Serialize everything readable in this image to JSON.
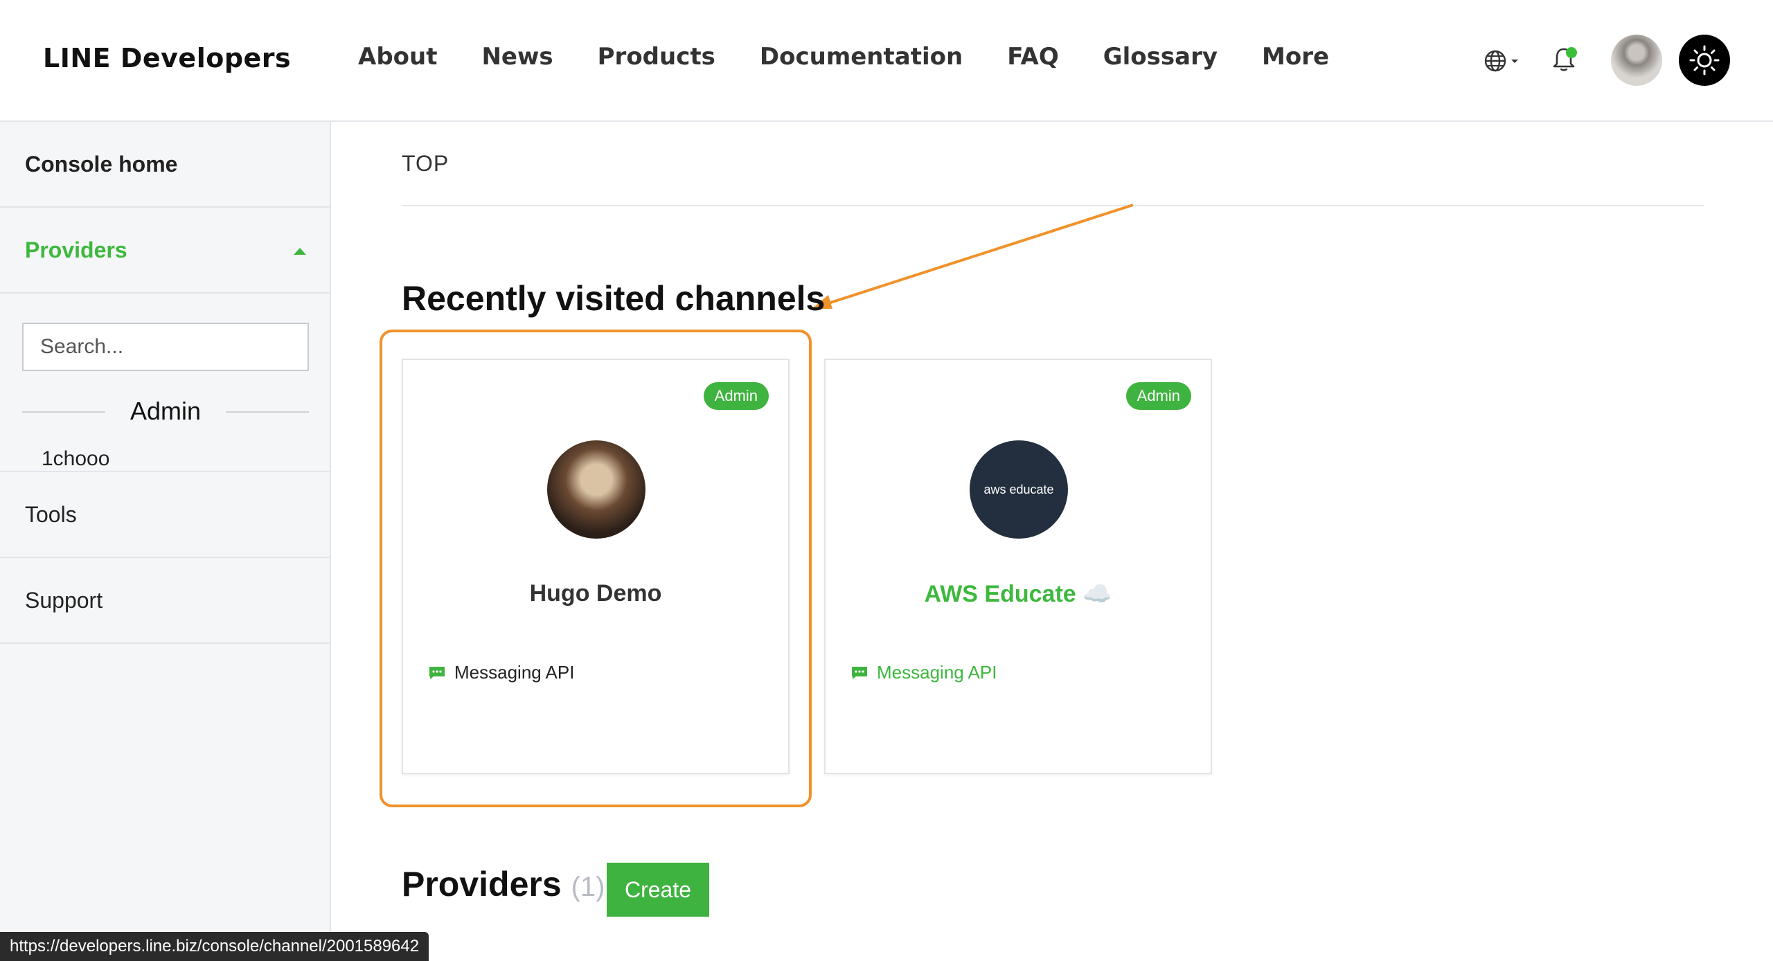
{
  "header": {
    "logo": "LINE Developers",
    "nav": [
      "About",
      "News",
      "Products",
      "Documentation",
      "FAQ",
      "Glossary",
      "More"
    ],
    "icons": {
      "language": "globe-icon",
      "notifications": "bell-icon",
      "theme": "sun-icon"
    },
    "notification_dot_color": "#3bbf3b"
  },
  "sidebar": {
    "console_home": "Console home",
    "providers": "Providers",
    "search_placeholder": "Search...",
    "group_label": "Admin",
    "provider_items": [
      "1chooo"
    ],
    "tools": "Tools",
    "support": "Support"
  },
  "main": {
    "breadcrumb": "TOP",
    "recent_title": "Recently visited channels",
    "channels": [
      {
        "name": "Hugo Demo",
        "badge": "Admin",
        "type": "Messaging API"
      },
      {
        "name": "AWS Educate ☁️",
        "badge": "Admin",
        "type": "Messaging API",
        "icon_text": "aws educate"
      }
    ],
    "providers_title": "Providers",
    "providers_count": "(1)",
    "create_label": "Create"
  },
  "status_bar": "https://developers.line.biz/console/channel/2001589642",
  "colors": {
    "accent_green": "#3db83d",
    "highlight_orange": "#f0922b",
    "sidebar_bg": "#f5f6f8"
  }
}
